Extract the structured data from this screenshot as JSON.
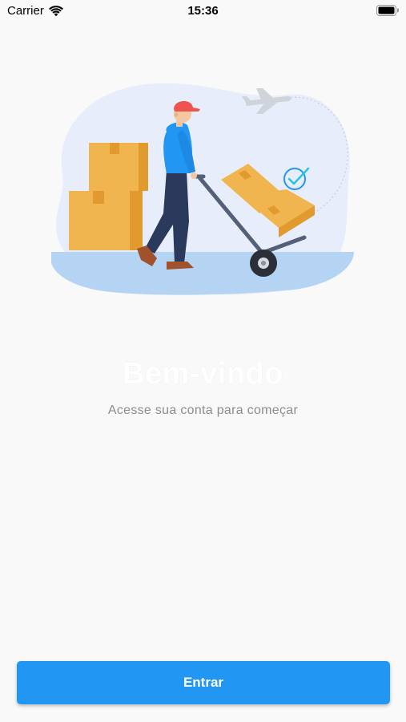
{
  "status_bar": {
    "carrier": "Carrier",
    "time": "15:36"
  },
  "welcome": {
    "title": "Bem-vindo",
    "subtitle": "Acesse sua conta para começar"
  },
  "actions": {
    "enter_label": "Entrar"
  },
  "colors": {
    "primary": "#2196f3",
    "background": "#f9f9f9",
    "subtitle": "#8c8c8c",
    "box": "#f0b54e",
    "shirt": "#2196f3",
    "cap": "#ef5350"
  },
  "illustration": {
    "name": "delivery-man-with-hand-truck"
  }
}
